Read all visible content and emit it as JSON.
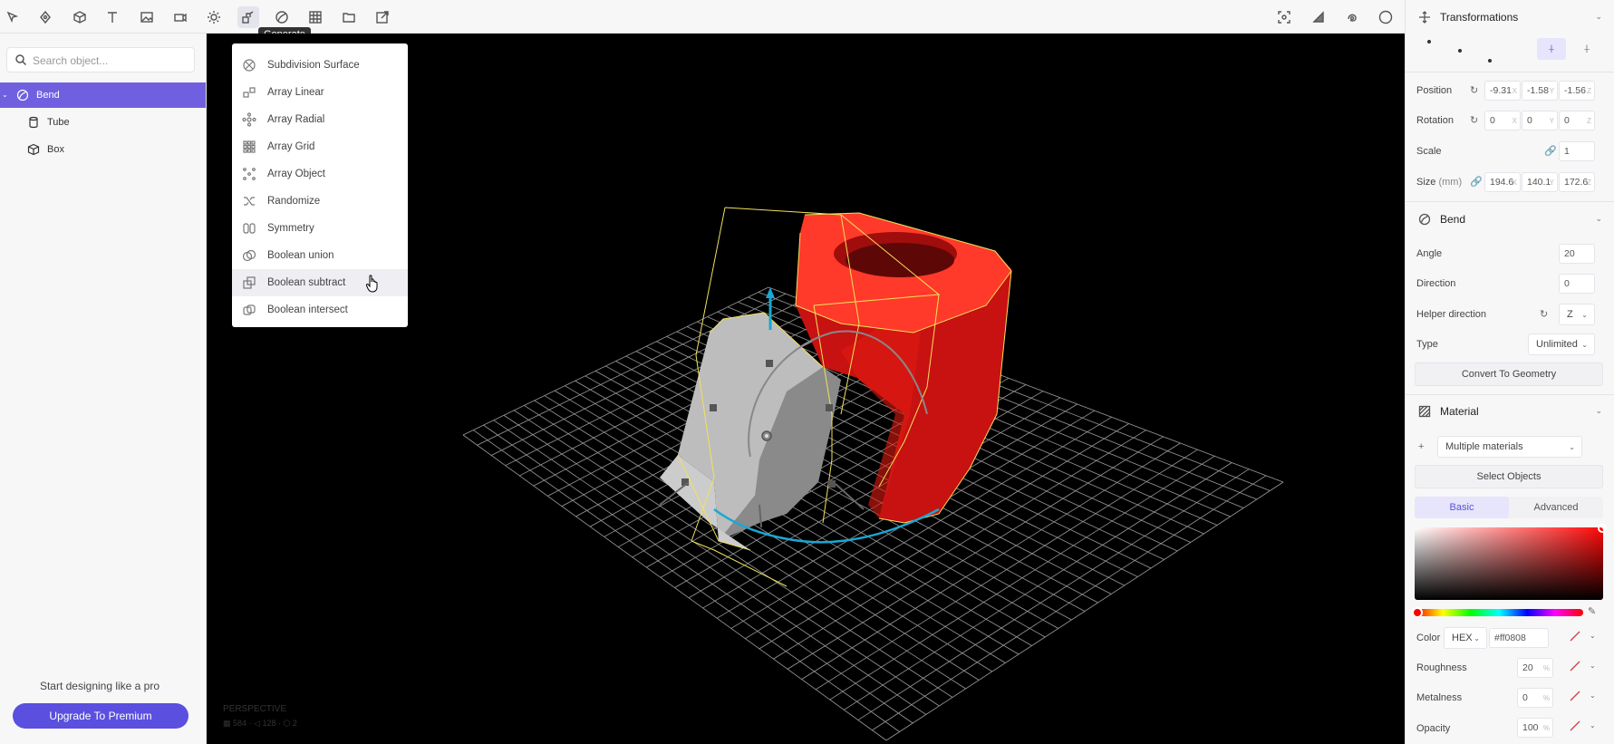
{
  "toolbar": {
    "left_icons": [
      "select-icon",
      "vector-icon",
      "cube-icon",
      "text-icon",
      "image-icon",
      "camera-icon",
      "light-icon",
      "generate-icon",
      "deform-icon",
      "texture-icon",
      "folder-icon",
      "export-icon"
    ],
    "right_icons": [
      "focus-icon",
      "render-icon",
      "gesture-icon",
      "sphere-icon"
    ],
    "tooltip": "Generate"
  },
  "left_panel": {
    "search_placeholder": "Search object...",
    "tree": [
      {
        "label": "Bend",
        "icon": "bend-icon",
        "selected": true
      },
      {
        "label": "Tube",
        "icon": "cylinder-icon",
        "selected": false
      },
      {
        "label": "Box",
        "icon": "cube-icon",
        "selected": false
      }
    ],
    "promo_text": "Start designing like a pro",
    "upgrade_label": "Upgrade To Premium"
  },
  "generate_menu": {
    "items": [
      {
        "label": "Subdivision Surface",
        "icon": "subdivision-icon"
      },
      {
        "label": "Array Linear",
        "icon": "array-linear-icon"
      },
      {
        "label": "Array Radial",
        "icon": "array-radial-icon"
      },
      {
        "label": "Array Grid",
        "icon": "array-grid-icon"
      },
      {
        "label": "Array Object",
        "icon": "array-object-icon"
      },
      {
        "label": "Randomize",
        "icon": "randomize-icon"
      },
      {
        "label": "Symmetry",
        "icon": "symmetry-icon"
      },
      {
        "label": "Boolean union",
        "icon": "boolean-union-icon"
      },
      {
        "label": "Boolean subtract",
        "icon": "boolean-subtract-icon",
        "hover": true
      },
      {
        "label": "Boolean intersect",
        "icon": "boolean-intersect-icon"
      }
    ]
  },
  "viewport": {
    "camera_label": "PERSPECTIVE",
    "stats": "▦ 584 · ◁ 128 · ⬡ 2"
  },
  "transformations": {
    "title": "Transformations",
    "position": {
      "label": "Position",
      "x": "-9.31",
      "y": "-1.58",
      "z": "-1.56"
    },
    "rotation": {
      "label": "Rotation",
      "x": "0",
      "y": "0",
      "z": "0"
    },
    "scale": {
      "label": "Scale",
      "value": "1"
    },
    "size": {
      "label": "Size",
      "unit": "(mm)",
      "x": "194.6",
      "y": "140.1",
      "z": "172.6"
    },
    "axis_x": "X",
    "axis_y": "Y",
    "axis_z": "Z"
  },
  "bend": {
    "title": "Bend",
    "angle": {
      "label": "Angle",
      "value": "20"
    },
    "direction": {
      "label": "Direction",
      "value": "0"
    },
    "helper_direction": {
      "label": "Helper direction",
      "value": "Z"
    },
    "type": {
      "label": "Type",
      "value": "Unlimited"
    },
    "convert_label": "Convert To Geometry"
  },
  "material": {
    "title": "Material",
    "select_value": "Multiple materials",
    "select_objects_label": "Select Objects",
    "tabs": [
      "Basic",
      "Advanced"
    ],
    "color": {
      "label": "Color",
      "mode": "HEX",
      "value": "#ff0808"
    },
    "roughness": {
      "label": "Roughness",
      "value": "20",
      "unit": "%"
    },
    "metalness": {
      "label": "Metalness",
      "value": "0",
      "unit": "%"
    },
    "opacity": {
      "label": "Opacity",
      "value": "100",
      "unit": "%"
    }
  },
  "colors": {
    "accent": "#5b4fe0",
    "selection": "#7060e0",
    "object_red": "#ff0808",
    "outline": "#f2e25a"
  }
}
